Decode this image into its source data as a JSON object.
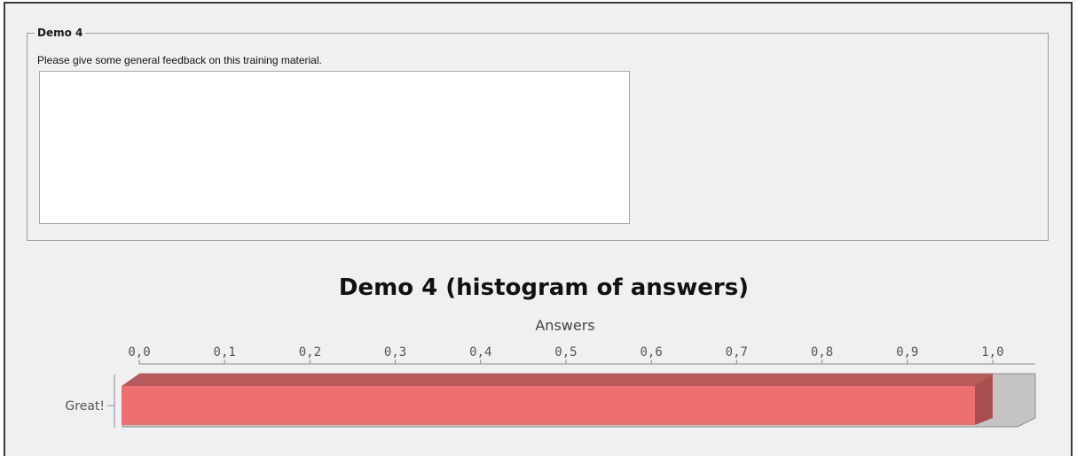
{
  "question": {
    "group_title": "Demo 4",
    "prompt": "Please give some general feedback on this training material.",
    "answer_value": ""
  },
  "chart_data": {
    "type": "bar",
    "orientation": "horizontal",
    "title": "Demo 4 (histogram of answers)",
    "axis_label": "Answers",
    "categories": [
      "Great!"
    ],
    "values": [
      1.0
    ],
    "xlim": [
      0.0,
      1.05
    ],
    "ticks": [
      "0,0",
      "0,1",
      "0,2",
      "0,3",
      "0,4",
      "0,5",
      "0,6",
      "0,7",
      "0,8",
      "0,9",
      "1,0"
    ],
    "tick_values": [
      0.0,
      0.1,
      0.2,
      0.3,
      0.4,
      0.5,
      0.6,
      0.7,
      0.8,
      0.9,
      1.0
    ],
    "bar_color": "#ee6f6f",
    "grid": false,
    "legend": "none"
  }
}
